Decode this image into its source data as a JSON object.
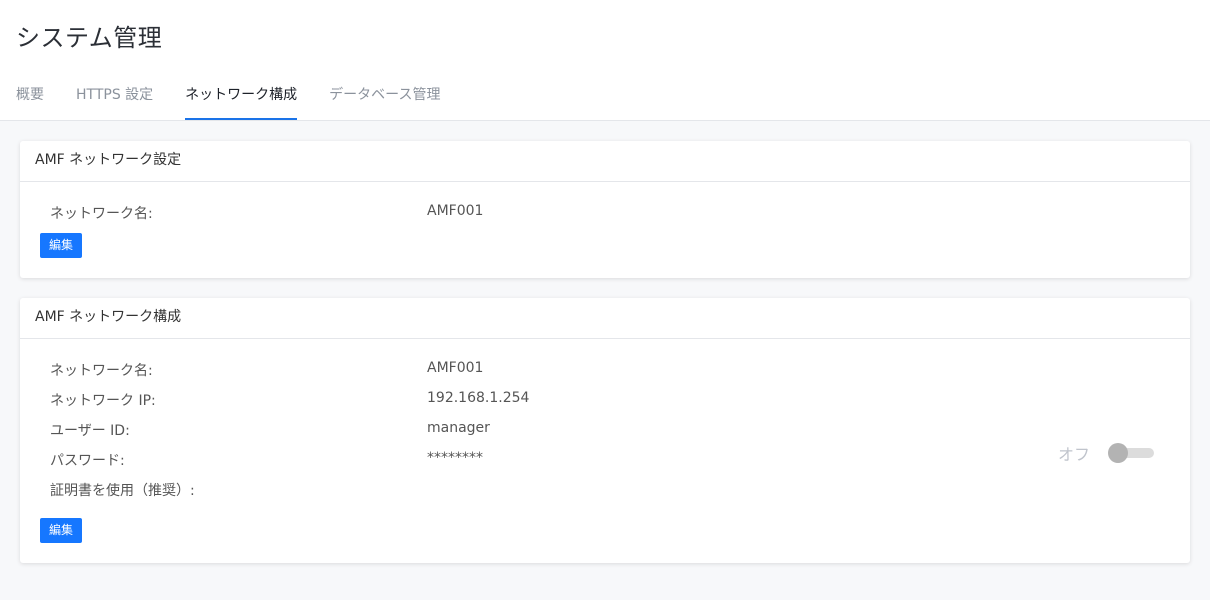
{
  "page": {
    "title": "システム管理"
  },
  "tabs": [
    {
      "label": "概要",
      "active": false
    },
    {
      "label": "HTTPS 設定",
      "active": false
    },
    {
      "label": "ネットワーク構成",
      "active": true
    },
    {
      "label": "データベース管理",
      "active": false
    }
  ],
  "network_settings": {
    "title": "AMF ネットワーク設定",
    "fields": [
      {
        "label": "ネットワーク名:",
        "value": "AMF001"
      }
    ],
    "edit_label": "編集"
  },
  "network_config": {
    "title": "AMF ネットワーク構成",
    "fields": [
      {
        "label": "ネットワーク名:",
        "value": "AMF001"
      },
      {
        "label": "ネットワーク IP:",
        "value": "192.168.1.254"
      },
      {
        "label": "ユーザー ID:",
        "value": "manager"
      },
      {
        "label": "パスワード:",
        "value": "********"
      }
    ],
    "cert_label": "証明書を使用（推奨）:",
    "cert_toggle_state": "オフ",
    "cert_enabled": false,
    "edit_label": "編集"
  },
  "colors": {
    "accent": "#1a73e8",
    "button": "#1677ff",
    "toggle_off_thumb": "#b3b3b3",
    "toggle_off_track": "#dcdcdc"
  }
}
